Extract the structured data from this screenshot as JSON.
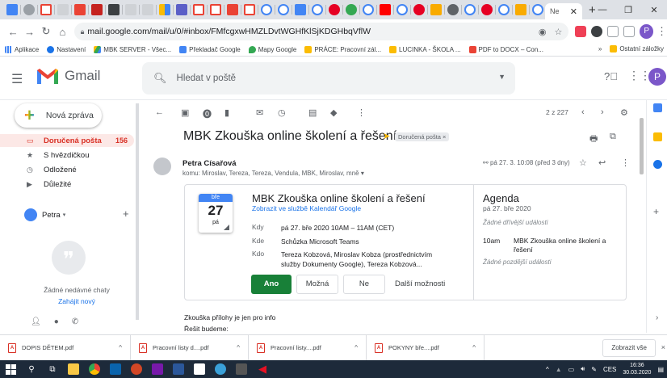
{
  "browser": {
    "active_tab_label": "Ne",
    "url": "mail.google.com/mail/u/0/#inbox/FMfcgxwHMZLDvtWGHfKlSjKDGHbqVflW",
    "profile_initial": "P",
    "colors": {
      "tabstrip": "#dee1e6",
      "omnibox": "#f1f3f4"
    },
    "bookmarks": [
      "Aplikace",
      "Nastavení",
      "MBK SERVER - Všec...",
      "Překladač Google",
      "Mapy Google",
      "PRÁCE: Pracovní zál...",
      "LUCINKA - ŠKOLA ...",
      "PDF to DOCX – Con..."
    ],
    "bookmarks_more": "»",
    "other_bookmarks": "Ostatní záložky"
  },
  "gmail": {
    "logo_text": "Gmail",
    "search_placeholder": "Hledat v poště",
    "avatar_initial": "P",
    "compose_label": "Nová zpráva",
    "nav": [
      {
        "label": "Doručená pošta",
        "count": "156"
      },
      {
        "label": "S hvězdičkou"
      },
      {
        "label": "Odložené"
      },
      {
        "label": "Důležité"
      }
    ],
    "hangouts_user": "Petra",
    "no_chats": "Žádné nedávné chaty",
    "start_new": "Zahájit nový",
    "pager": "2 z 227"
  },
  "message": {
    "subject": "MBK Zkouška online školení a řešení",
    "label_chip": "Doručená pošta ×",
    "sender": "Petra Císařová",
    "recipients": "komu: Miroslav, Tereza, Tereza, Vendula, MBK, Miroslav, mně ▾",
    "date": "pá 27. 3. 10:08 (před 3 dny)",
    "body_line1": "Zkouška přílohy je jen pro info",
    "body_line2": "Řešit budeme:"
  },
  "invite": {
    "cal_month": "bře",
    "cal_day": "27",
    "cal_dow": "pá",
    "title": "MBK Zkouška online školení a řešení",
    "cal_link": "Zobrazit ve službě Kalendář Google",
    "rows": [
      {
        "key": "Kdy",
        "value": "pá 27. bře 2020 10AM – 11AM (CET)"
      },
      {
        "key": "Kde",
        "value": "Schůzka Microsoft Teams"
      },
      {
        "key": "Kdo",
        "value": "Tereza Kobzová, Miroslav Kobza (prostřednictvím služby Dokumenty Google), Tereza Kobzová..."
      }
    ],
    "btn_yes": "Ano",
    "btn_maybe": "Možná",
    "btn_no": "Ne",
    "btn_more": "Další možnosti",
    "colors": {
      "yes": "#188038",
      "link": "#1a73e8"
    }
  },
  "agenda": {
    "title": "Agenda",
    "date": "pá 27. bře 2020",
    "none_before": "Žádné dřívější události",
    "time": "10am",
    "event": "MBK Zkouška online školení a řešení",
    "none_after": "Žádné pozdější události"
  },
  "downloads": {
    "items": [
      "DOPIS DĚTEM.pdf",
      "Pracovní listy   d....pdf",
      "Pracovní listy....pdf",
      "POKYNY        bře....pdf"
    ],
    "show_all": "Zobrazit vše",
    "close": "×"
  },
  "taskbar": {
    "lang": "CES",
    "time": "16:36",
    "date": "30.03.2020"
  }
}
